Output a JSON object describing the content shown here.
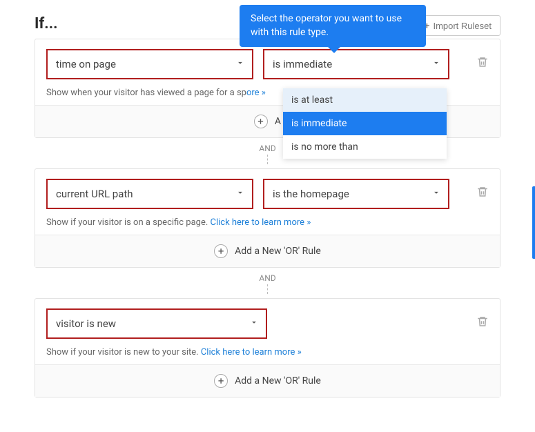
{
  "header": {
    "title": "If...",
    "import_label": "Import Ruleset"
  },
  "tooltip": "Select the operator you want to use with this rule type.",
  "dropdown": {
    "items": [
      "is at least",
      "is immediate",
      "is no more than"
    ],
    "selected_index": 1
  },
  "rules": [
    {
      "rule_type": "time on page",
      "operator": "is immediate",
      "help_text": "Show when your visitor has viewed a page for a sp",
      "help_link": "ore »"
    },
    {
      "rule_type": "current URL path",
      "operator": "is the homepage",
      "help_text": "Show if your visitor is on a specific page. ",
      "help_link": "Click here to learn more »"
    },
    {
      "rule_type": "visitor is new",
      "operator": null,
      "help_text": "Show if your visitor is new to your site. ",
      "help_link": "Click here to learn more »"
    }
  ],
  "and_label": "AND",
  "addor_label": "Add a New 'OR' Rule",
  "addor_label_short": "A"
}
